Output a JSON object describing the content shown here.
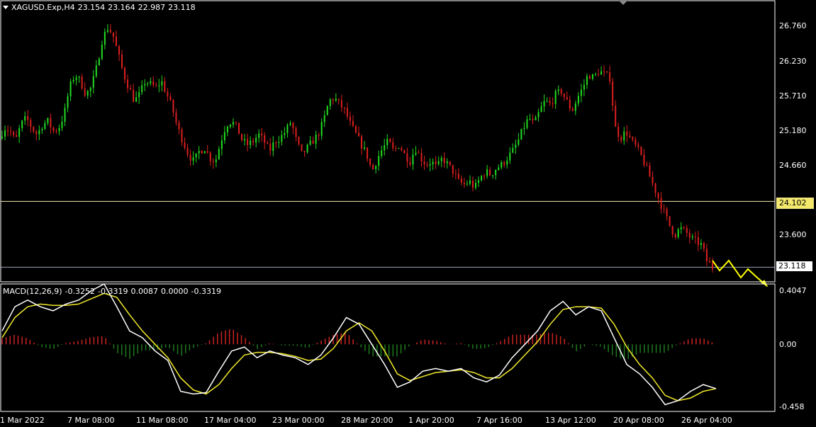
{
  "symbol": {
    "name": "XAGUSD.Exp,H4",
    "open": "23.154",
    "high": "23.164",
    "low": "22.987",
    "close": "23.118"
  },
  "price_axis": {
    "ticks": [
      "26.760",
      "26.230",
      "25.710",
      "25.180",
      "24.660",
      "23.600"
    ],
    "hline_label": "24.102",
    "bid_label": "23.118"
  },
  "macd": {
    "params": "MACD(12,26,9)",
    "v1": "-0.3252",
    "v2": "-0.3319",
    "v3": "0.0087",
    "v4": "0.0000",
    "v5": "-0.3319",
    "ticks": [
      "0.4047",
      "0.00",
      "-0.458"
    ]
  },
  "time_axis": {
    "ticks": [
      "1 Mar 2022",
      "7 Mar 08:00",
      "11 Mar 08:00",
      "17 Mar 04:00",
      "23 Mar 00:00",
      "28 Mar 20:00",
      "1 Apr 20:00",
      "7 Apr 16:00",
      "13 Apr 12:00",
      "20 Apr 08:00",
      "26 Apr 04:00"
    ]
  },
  "colors": {
    "background": "#000000",
    "bull_candle": "#22dd22",
    "bear_candle": "#dd1f1f",
    "macd_main": "#ffffff",
    "macd_signal": "#f2ea2a",
    "hist_pos": "#cc2222",
    "hist_neg": "#1e7a1e",
    "arrows": "#ffff00"
  },
  "chart_data": {
    "type": "candlestick",
    "instrument": "XAGUSD.Exp",
    "timeframe": "H4",
    "close_path": [
      25.05,
      25.2,
      25.15,
      25.0,
      25.25,
      25.35,
      25.2,
      25.1,
      25.25,
      25.3,
      25.15,
      25.2,
      25.4,
      25.8,
      26.0,
      25.9,
      25.7,
      25.8,
      26.1,
      26.5,
      26.7,
      26.6,
      26.3,
      26.0,
      25.8,
      25.6,
      25.7,
      25.9,
      25.85,
      25.8,
      25.9,
      25.7,
      25.5,
      25.2,
      25.0,
      24.8,
      24.7,
      24.85,
      24.9,
      24.75,
      24.7,
      25.0,
      25.25,
      25.3,
      25.2,
      25.0,
      24.95,
      25.0,
      25.1,
      25.0,
      24.85,
      25.0,
      25.05,
      25.15,
      25.3,
      25.0,
      24.8,
      24.9,
      25.0,
      25.1,
      25.3,
      25.6,
      25.65,
      25.55,
      25.45,
      25.25,
      25.1,
      24.95,
      24.8,
      24.55,
      24.75,
      24.9,
      25.0,
      24.85,
      24.95,
      24.8,
      24.7,
      24.9,
      24.75,
      24.65,
      24.7,
      24.6,
      24.75,
      24.65,
      24.55,
      24.4,
      24.35,
      24.4,
      24.3,
      24.45,
      24.55,
      24.5,
      24.6,
      24.65,
      24.75,
      24.85,
      25.0,
      25.2,
      25.35,
      25.25,
      25.45,
      25.6,
      25.55,
      25.7,
      25.75,
      25.6,
      25.45,
      25.65,
      25.8,
      26.0,
      25.95,
      26.05,
      26.0,
      25.95,
      25.2,
      25.05,
      25.15,
      25.0,
      24.9,
      24.75,
      24.55,
      24.35,
      24.15,
      23.95,
      23.75,
      23.6,
      23.7,
      23.65,
      23.55,
      23.5,
      23.45,
      23.2,
      23.118
    ],
    "macd_main": [
      0.1,
      0.28,
      0.33,
      0.28,
      0.25,
      0.3,
      0.33,
      0.4,
      0.45,
      0.28,
      0.1,
      0.05,
      -0.05,
      -0.12,
      -0.35,
      -0.37,
      -0.36,
      -0.2,
      -0.05,
      -0.02,
      -0.1,
      -0.05,
      -0.08,
      -0.1,
      -0.15,
      -0.08,
      0.05,
      0.2,
      0.15,
      0.0,
      -0.15,
      -0.32,
      -0.28,
      -0.2,
      -0.18,
      -0.2,
      -0.18,
      -0.25,
      -0.28,
      -0.23,
      -0.1,
      0.0,
      0.1,
      0.25,
      0.32,
      0.22,
      0.28,
      0.25,
      0.05,
      -0.15,
      -0.22,
      -0.32,
      -0.45,
      -0.42,
      -0.35,
      -0.3,
      -0.33
    ],
    "macd_signal": [
      0.05,
      0.2,
      0.28,
      0.3,
      0.29,
      0.29,
      0.3,
      0.34,
      0.38,
      0.35,
      0.22,
      0.1,
      0.0,
      -0.1,
      -0.25,
      -0.34,
      -0.37,
      -0.3,
      -0.18,
      -0.08,
      -0.06,
      -0.06,
      -0.07,
      -0.09,
      -0.12,
      -0.11,
      -0.03,
      0.1,
      0.16,
      0.1,
      -0.05,
      -0.22,
      -0.27,
      -0.24,
      -0.21,
      -0.2,
      -0.19,
      -0.21,
      -0.25,
      -0.25,
      -0.18,
      -0.08,
      0.02,
      0.15,
      0.26,
      0.28,
      0.28,
      0.27,
      0.15,
      -0.02,
      -0.15,
      -0.25,
      -0.38,
      -0.42,
      -0.4,
      -0.35,
      -0.33
    ],
    "hline": 24.102,
    "price_range": [
      22.9,
      27.1
    ],
    "macd_range": [
      -0.5,
      0.45
    ]
  }
}
